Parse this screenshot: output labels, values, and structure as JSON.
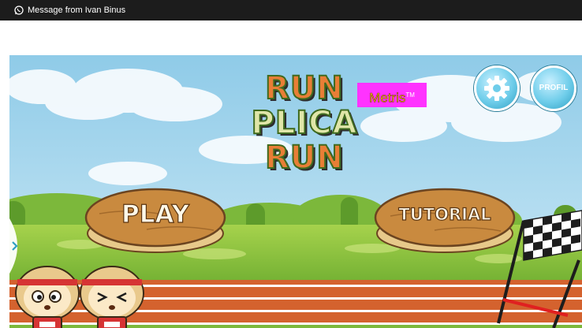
{
  "notification": {
    "icon": "whatsapp-icon",
    "text": "Message from Ivan Binus"
  },
  "game": {
    "title_lines": [
      "RUN",
      "PLICA",
      "RUN"
    ],
    "brand_badge": "Metris",
    "brand_mark": "TM",
    "settings_icon": "gear-icon",
    "profile_label": "PROFIL",
    "play_label": "PLAY",
    "tutorial_label": "TUTORIAL"
  },
  "colors": {
    "notification_bar": "#1c1c1c",
    "sky": "#a8d8ef",
    "grass": "#8ac13f",
    "track": "#d4622e",
    "title_orange": "#e87e36",
    "title_cream": "#e0e6a8",
    "badge": "#ff33ff",
    "badge_text": "#ffdb1a",
    "button_blue": "#6fcdea",
    "wood": "#c98a3f"
  }
}
